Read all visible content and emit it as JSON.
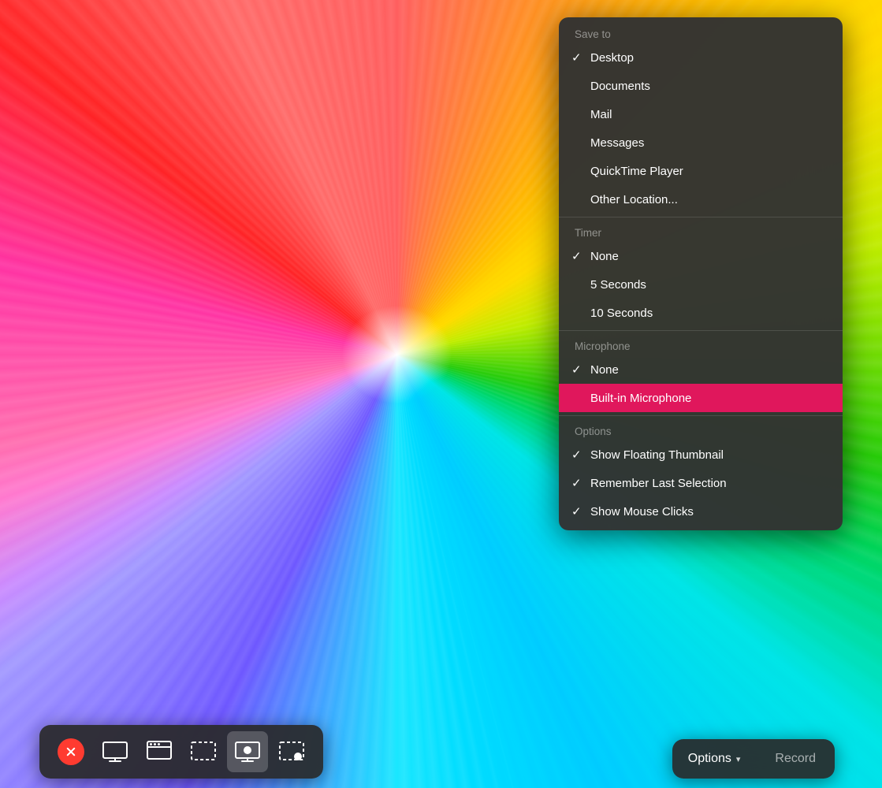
{
  "background": {
    "description": "colorful abstract wallpaper with radial streaks"
  },
  "dropdown": {
    "sections": [
      {
        "id": "save-to",
        "label": "Save to",
        "items": [
          {
            "id": "desktop",
            "text": "Desktop",
            "checked": true,
            "highlighted": false
          },
          {
            "id": "documents",
            "text": "Documents",
            "checked": false,
            "highlighted": false
          },
          {
            "id": "mail",
            "text": "Mail",
            "checked": false,
            "highlighted": false
          },
          {
            "id": "messages",
            "text": "Messages",
            "checked": false,
            "highlighted": false
          },
          {
            "id": "quicktime",
            "text": "QuickTime Player",
            "checked": false,
            "highlighted": false
          },
          {
            "id": "other-location",
            "text": "Other Location...",
            "checked": false,
            "highlighted": false
          }
        ]
      },
      {
        "id": "timer",
        "label": "Timer",
        "items": [
          {
            "id": "timer-none",
            "text": "None",
            "checked": true,
            "highlighted": false
          },
          {
            "id": "timer-5s",
            "text": "5 Seconds",
            "checked": false,
            "highlighted": false
          },
          {
            "id": "timer-10s",
            "text": "10 Seconds",
            "checked": false,
            "highlighted": false
          }
        ]
      },
      {
        "id": "microphone",
        "label": "Microphone",
        "items": [
          {
            "id": "mic-none",
            "text": "None",
            "checked": true,
            "highlighted": false
          },
          {
            "id": "mic-builtin",
            "text": "Built-in Microphone",
            "checked": false,
            "highlighted": true
          }
        ]
      },
      {
        "id": "options",
        "label": "Options",
        "items": [
          {
            "id": "show-floating-thumbnail",
            "text": "Show Floating Thumbnail",
            "checked": true,
            "highlighted": false
          },
          {
            "id": "remember-last-selection",
            "text": "Remember Last Selection",
            "checked": true,
            "highlighted": false
          },
          {
            "id": "show-mouse-clicks",
            "text": "Show Mouse Clicks",
            "checked": true,
            "highlighted": false
          }
        ]
      }
    ]
  },
  "toolbar": {
    "buttons": [
      {
        "id": "close",
        "type": "close",
        "label": "Close"
      },
      {
        "id": "capture-screen",
        "type": "screen",
        "label": "Capture Entire Screen"
      },
      {
        "id": "capture-window",
        "type": "window",
        "label": "Capture Selected Window"
      },
      {
        "id": "capture-selection",
        "type": "selection",
        "label": "Capture Selected Portion"
      },
      {
        "id": "record-screen",
        "type": "record-screen",
        "label": "Record Entire Screen",
        "active": true
      },
      {
        "id": "record-selection",
        "type": "record-selection",
        "label": "Record Selected Portion"
      }
    ],
    "options_label": "Options",
    "record_label": "Record",
    "chevron": "▾"
  }
}
